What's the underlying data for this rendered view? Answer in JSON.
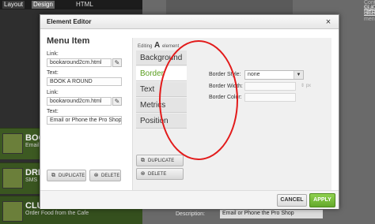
{
  "background": {
    "tabs": [
      "Layout",
      "Design",
      "HTML"
    ],
    "right_sub_text": "Content to a different menu",
    "right_link_text": "CLICK HERE!",
    "rows": [
      {
        "title": "BOO",
        "sub": "Email or P"
      },
      {
        "title": "DRI",
        "sub": "SMS"
      },
      {
        "title": "CLU",
        "sub": "Order Food from the Cafe"
      }
    ],
    "description_label": "Description:",
    "description_value": "Email or Phone the Pro Shop"
  },
  "modal": {
    "title": "Element Editor",
    "close_icon": "×",
    "menu_item": {
      "heading": "Menu Item",
      "link1_label": "Link:",
      "link1_value": "bookaround2cm.html",
      "text1_label": "Text:",
      "text1_value": "BOOK A ROUND",
      "link2_label": "Link:",
      "link2_value": "bookaround2cm.html",
      "text2_label": "Text:",
      "text2_value": "Email or Phone the Pro Shop",
      "duplicate_label": "DUPLICATE",
      "delete_label": "DELETE"
    },
    "editor": {
      "editing_prefix": "Editing",
      "editing_big": "A",
      "editing_suffix": "element",
      "tabs": [
        "Background",
        "Border",
        "Text",
        "Metrics",
        "Position"
      ],
      "active_tab": "Border",
      "border_style_label": "Border Style:",
      "border_style_value": "none",
      "border_width_label": "Border Width:",
      "border_width_unit": "px",
      "border_color_label": "Border Color:",
      "duplicate_label": "DUPLICATE",
      "delete_label": "DELETE"
    },
    "footer": {
      "cancel_label": "CANCEL",
      "apply_label": "APPLY"
    },
    "colors": {
      "apply_green": "#63a82b",
      "active_tab_text": "#5a9e1e",
      "annotation_red": "#e21b1b"
    }
  }
}
